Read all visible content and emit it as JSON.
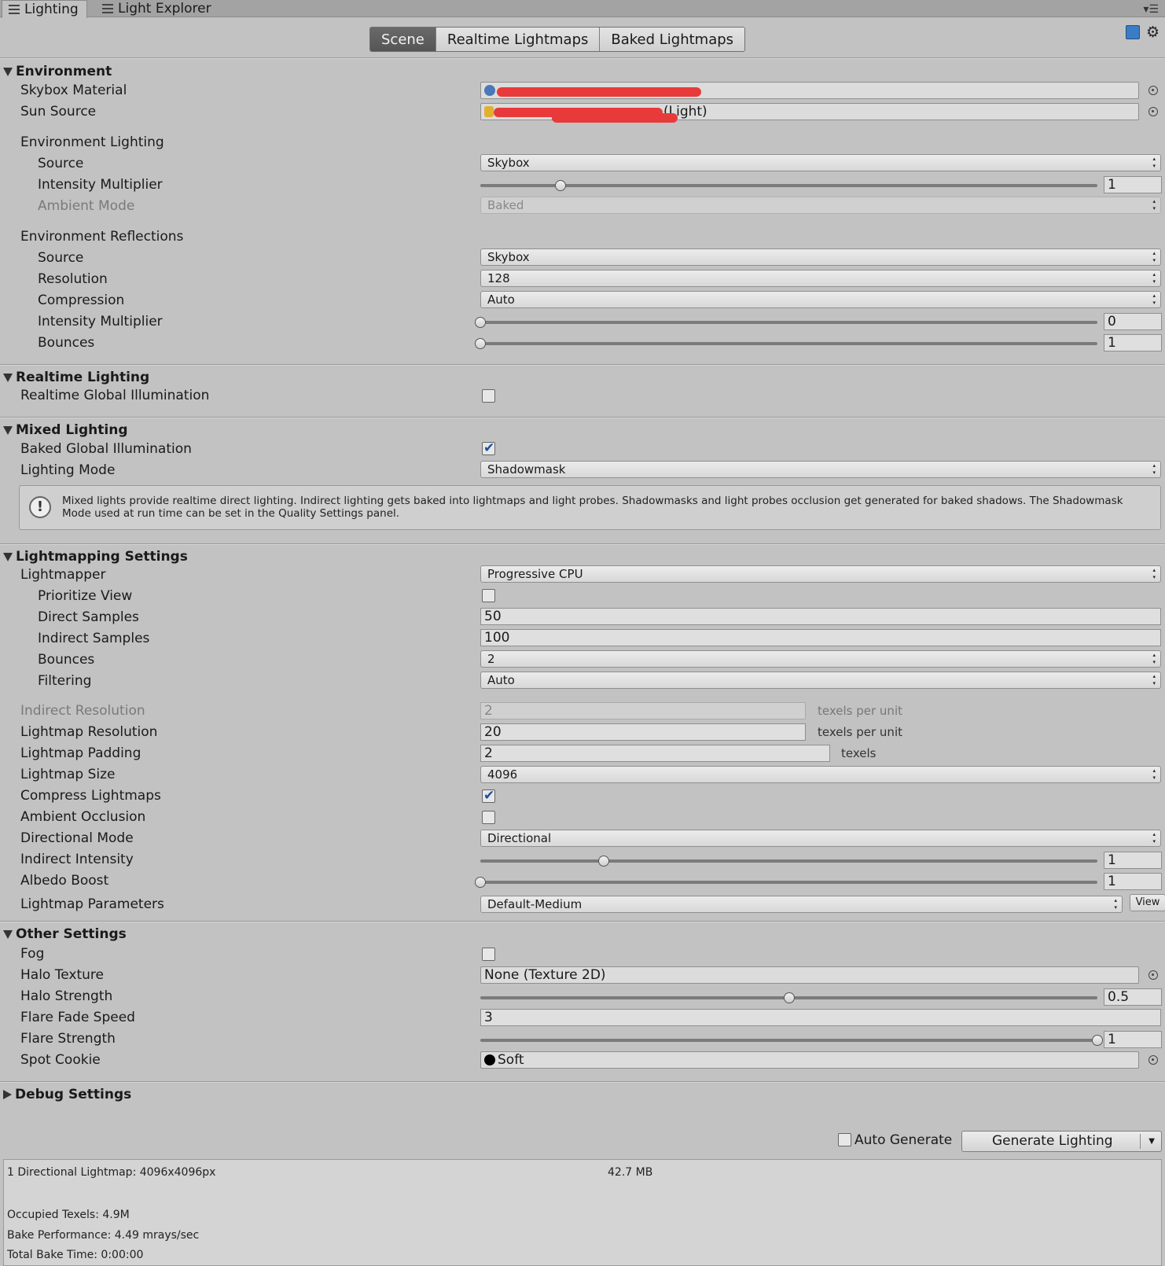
{
  "window_tabs": [
    {
      "label": "Lighting",
      "active": true
    },
    {
      "label": "Light Explorer",
      "active": false
    }
  ],
  "top_tabs": [
    {
      "label": "Scene",
      "active": true
    },
    {
      "label": "Realtime Lightmaps",
      "active": false
    },
    {
      "label": "Baked Lightmaps",
      "active": false
    }
  ],
  "environment": {
    "header": "Environment",
    "skybox_material": {
      "label": "Skybox Material",
      "value": ""
    },
    "sun_source": {
      "label": "Sun Source",
      "value": "(Light)"
    },
    "env_lighting": {
      "label": "Environment Lighting",
      "source": {
        "label": "Source",
        "value": "Skybox"
      },
      "intensity": {
        "label": "Intensity Multiplier",
        "value": "1",
        "level": 0.13
      },
      "ambient_mode": {
        "label": "Ambient Mode",
        "value": "Baked"
      }
    },
    "env_reflections": {
      "label": "Environment Reflections",
      "source": {
        "label": "Source",
        "value": "Skybox"
      },
      "resolution": {
        "label": "Resolution",
        "value": "128"
      },
      "compression": {
        "label": "Compression",
        "value": "Auto"
      },
      "intensity": {
        "label": "Intensity Multiplier",
        "value": "0",
        "level": 0
      },
      "bounces": {
        "label": "Bounces",
        "value": "1",
        "level": 0
      }
    }
  },
  "realtime": {
    "header": "Realtime Lighting",
    "rt_gi": {
      "label": "Realtime Global Illumination",
      "checked": false
    }
  },
  "mixed": {
    "header": "Mixed Lighting",
    "baked_gi": {
      "label": "Baked Global Illumination",
      "checked": true
    },
    "mode": {
      "label": "Lighting Mode",
      "value": "Shadowmask"
    },
    "help": "Mixed lights provide realtime direct lighting. Indirect lighting gets baked into lightmaps and light probes. Shadowmasks and light probes occlusion get generated for baked shadows. The Shadowmask Mode used at run time can be set in the Quality Settings panel."
  },
  "lightmapping": {
    "header": "Lightmapping Settings",
    "lightmapper": {
      "label": "Lightmapper",
      "value": "Progressive CPU"
    },
    "prioritize": {
      "label": "Prioritize View",
      "checked": false
    },
    "direct": {
      "label": "Direct Samples",
      "value": "50"
    },
    "indirect": {
      "label": "Indirect Samples",
      "value": "100"
    },
    "bounces": {
      "label": "Bounces",
      "value": "2"
    },
    "filtering": {
      "label": "Filtering",
      "value": "Auto"
    },
    "indirect_res": {
      "label": "Indirect Resolution",
      "value": "2",
      "unit": "texels per unit"
    },
    "lightmap_res": {
      "label": "Lightmap Resolution",
      "value": "20",
      "unit": "texels per unit"
    },
    "padding": {
      "label": "Lightmap Padding",
      "value": "2",
      "unit": "texels"
    },
    "size": {
      "label": "Lightmap Size",
      "value": "4096"
    },
    "compress": {
      "label": "Compress Lightmaps",
      "checked": true
    },
    "ao": {
      "label": "Ambient Occlusion",
      "checked": false
    },
    "dir_mode": {
      "label": "Directional Mode",
      "value": "Directional"
    },
    "ind_intensity": {
      "label": "Indirect Intensity",
      "value": "1",
      "level": 0.2
    },
    "albedo": {
      "label": "Albedo Boost",
      "value": "1",
      "level": 0
    },
    "params": {
      "label": "Lightmap Parameters",
      "value": "Default-Medium",
      "view": "View"
    }
  },
  "other": {
    "header": "Other Settings",
    "fog": {
      "label": "Fog",
      "checked": false
    },
    "halo_tex": {
      "label": "Halo Texture",
      "value": "None (Texture 2D)"
    },
    "halo_strength": {
      "label": "Halo Strength",
      "value": "0.5",
      "level": 0.5
    },
    "flare_fade": {
      "label": "Flare Fade Speed",
      "value": "3"
    },
    "flare_strength": {
      "label": "Flare Strength",
      "value": "1",
      "level": 1
    },
    "spot_cookie": {
      "label": "Spot Cookie",
      "value": "Soft"
    }
  },
  "debug": {
    "header": "Debug Settings"
  },
  "footer": {
    "auto_generate": {
      "label": "Auto Generate",
      "checked": false
    },
    "generate": "Generate Lighting"
  },
  "stats": {
    "lightmaps": "1 Directional Lightmap: 4096x4096px",
    "size": "42.7 MB",
    "occupied": "Occupied Texels: 4.9M",
    "performance": "Bake Performance: 4.49 mrays/sec",
    "bake_time": "Total Bake Time: 0:00:00"
  }
}
